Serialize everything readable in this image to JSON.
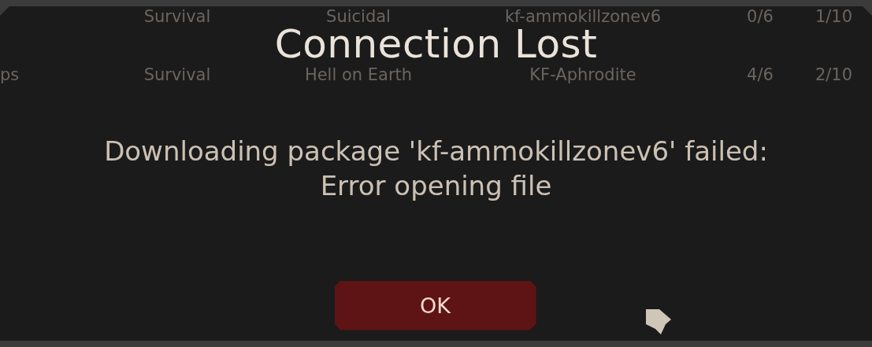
{
  "background_table": {
    "rows": [
      {
        "mode": "Survival",
        "difficulty": "Suicidal",
        "map": "kf-ammokillzonev6",
        "players": "0/6",
        "column_6": "1/10"
      },
      {
        "column_1": "ps",
        "mode": "Survival",
        "difficulty": "Hell on Earth",
        "map": "KF-Aphrodite",
        "players": "4/6",
        "column_6": "2/10"
      }
    ]
  },
  "dialog": {
    "title": "Connection Lost",
    "message_lines": [
      "Downloading package 'kf-ammokillzonev6' failed:",
      "Error opening file"
    ],
    "buttons": [
      "OK"
    ]
  }
}
